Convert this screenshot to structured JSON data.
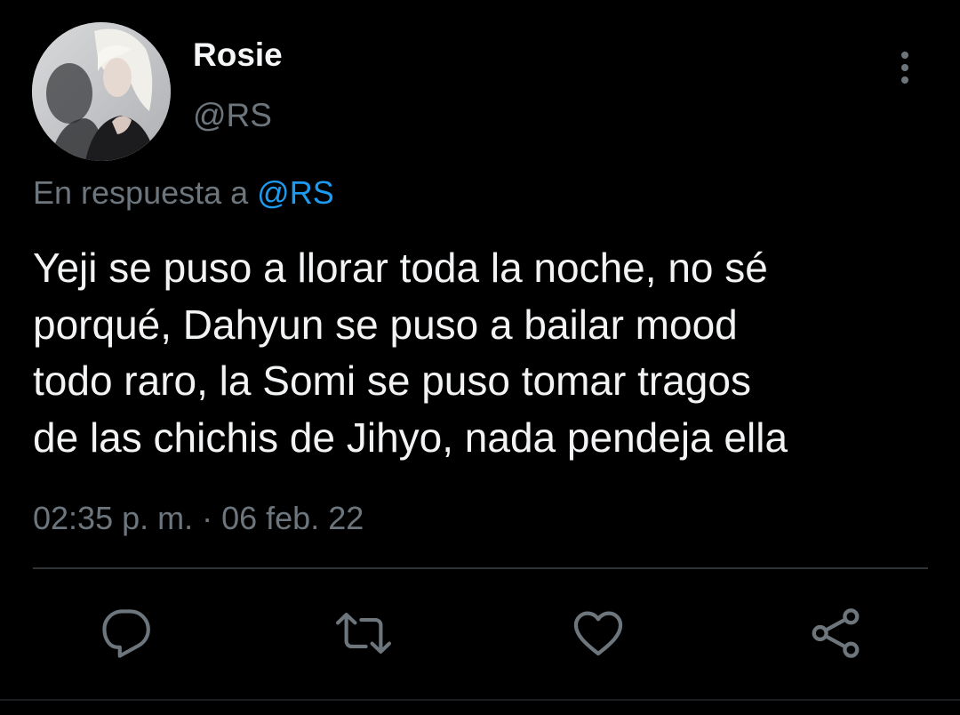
{
  "author": {
    "name": "Rosie",
    "handle": "@RS"
  },
  "reply_context": {
    "prefix": "En respuesta a ",
    "mention": "@RS"
  },
  "tweet": {
    "lines": [
      "Yeji se puso a llorar toda la noche, no sé",
      "porqué, Dahyun se puso a bailar mood",
      "todo raro, la Somi se puso tomar tragos",
      "de las chichis de Jihyo, nada pendeja ella"
    ],
    "timestamp": "02:35 p. m. · 06 feb. 22"
  },
  "actions": [
    {
      "icon": "reply-icon"
    },
    {
      "icon": "retweet-icon"
    },
    {
      "icon": "heart-icon"
    },
    {
      "icon": "share-icon"
    }
  ],
  "colors": {
    "background": "#000000",
    "secondary_text": "#6e767d",
    "link": "#1d9bf0",
    "primary_text": "#e7e9ea"
  }
}
